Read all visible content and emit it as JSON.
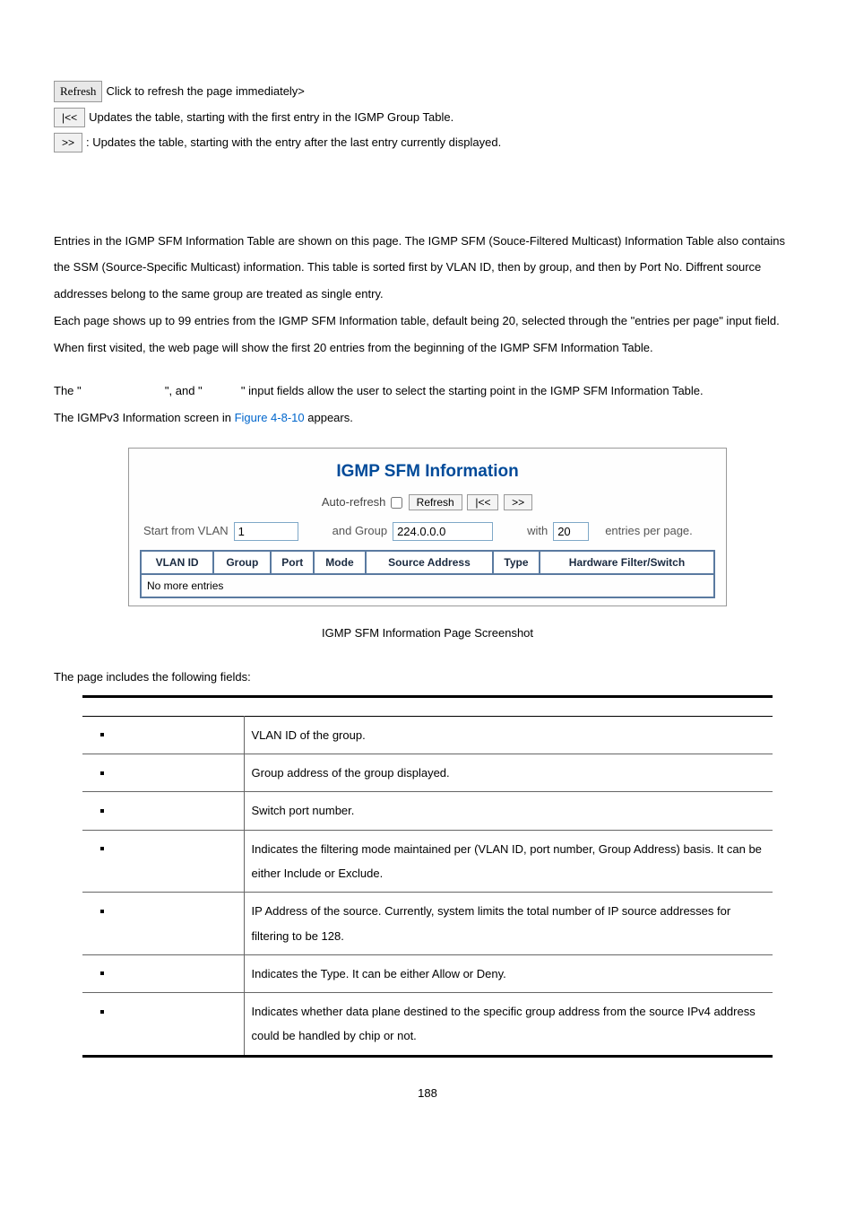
{
  "buttons": {
    "refresh": {
      "label": "Refresh",
      "desc": " Click to refresh the page immediately>"
    },
    "first": {
      "label": "|<<",
      "desc": " Updates the table, starting with the first entry in the IGMP Group Table."
    },
    "next": {
      "label": ">>",
      "desc": ": Updates the table, starting with the entry after the last entry currently displayed."
    }
  },
  "paragraphs": {
    "p1": "Entries in the IGMP SFM Information Table are shown on this page. The IGMP SFM (Souce-Filtered Multicast) Information Table also contains the SSM (Source-Specific Multicast) information. This table is sorted first by VLAN ID, then by group, and then by Port No. Diffrent source addresses belong to the same group are treated as single entry.",
    "p2": "Each page shows up to 99 entries from the IGMP SFM Information table, default being 20, selected through the \"entries per page\" input field. When first visited, the web page will show the first 20 entries from the beginning of the IGMP SFM Information Table.",
    "p3a": "The \"",
    "p3b": "\", and \"",
    "p3c": "\" input fields allow the user to select the starting point in the IGMP SFM Information Table.",
    "p4a": "The IGMPv3 Information screen in ",
    "p4link": "Figure 4-8-10",
    "p4b": " appears."
  },
  "screenshot": {
    "title": "IGMP SFM Information",
    "auto_refresh_label": "Auto-refresh",
    "btn_refresh": "Refresh",
    "btn_first": "|<<",
    "btn_next": ">>",
    "filter": {
      "start_label": "Start from VLAN",
      "vlan_value": "1",
      "group_label": "and Group",
      "group_value": "224.0.0.0",
      "with_label": "with",
      "entries_value": "20",
      "entries_label": "entries per page."
    },
    "headers": [
      "VLAN ID",
      "Group",
      "Port",
      "Mode",
      "Source Address",
      "Type",
      "Hardware Filter/Switch"
    ],
    "row": "No more entries"
  },
  "caption": "IGMP SFM Information Page Screenshot",
  "fields_intro": "The page includes the following fields:",
  "fields": [
    {
      "desc": "VLAN ID of the group."
    },
    {
      "desc": "Group address of the group displayed."
    },
    {
      "desc": "Switch port number."
    },
    {
      "desc": "Indicates the filtering mode maintained per (VLAN ID, port number, Group Address) basis. It can be either Include or Exclude."
    },
    {
      "desc": "IP Address of the source. Currently, system limits the total number of IP source addresses for filtering to be 128."
    },
    {
      "desc": "Indicates the Type. It can be either Allow or Deny."
    },
    {
      "desc": "Indicates whether data plane destined to the specific group address from the source IPv4 address could be handled by chip or not."
    }
  ],
  "page_number": "188"
}
